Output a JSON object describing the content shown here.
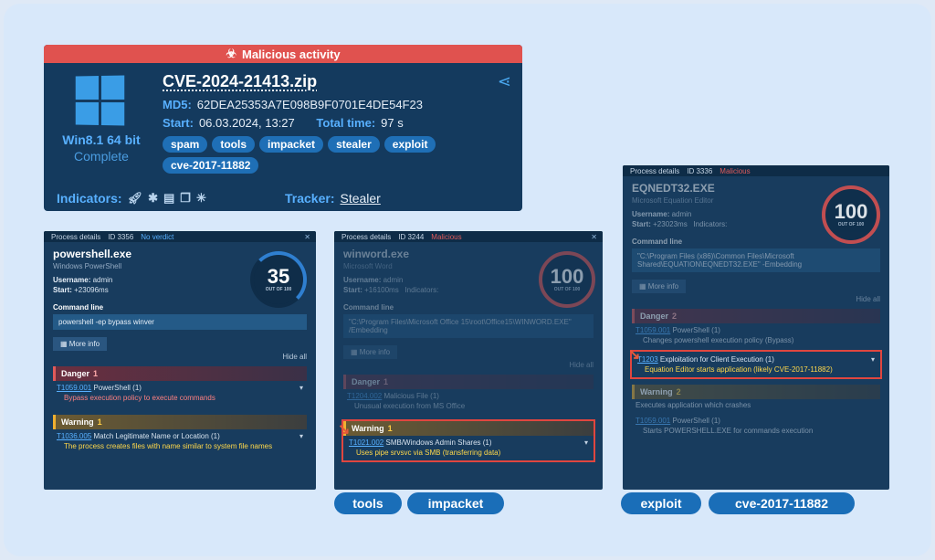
{
  "summary": {
    "banner": "Malicious activity",
    "os": "Win8.1 64 bit",
    "status": "Complete",
    "filename": "CVE-2024-21413.zip",
    "md5_label": "MD5:",
    "md5": "62DEA25353A7E098B9F0701E4DE54F23",
    "start_label": "Start:",
    "start": "06.03.2024, 13:27",
    "total_label": "Total time:",
    "total": "97 s",
    "tags": [
      "spam",
      "tools",
      "impacket",
      "stealer",
      "exploit",
      "cve-2017-11882"
    ],
    "indicators_label": "Indicators:",
    "tracker_label": "Tracker:",
    "tracker": "Stealer"
  },
  "p1": {
    "hdr": "Process details",
    "id": "ID 3356",
    "verdict": "No verdict",
    "name": "powershell.exe",
    "sub": "Windows PowerShell",
    "user_label": "Username:",
    "user": "admin",
    "start_label": "Start:",
    "start": "+23096ms",
    "score": "35",
    "outof": "OUT OF 100",
    "cmd_label": "Command line",
    "cmd": "powershell -ep bypass winver",
    "more": "More info",
    "hide": "Hide all",
    "danger": "Danger",
    "danger_count": "1",
    "d1_id": "T1059.001",
    "d1_text": " PowerShell (1)",
    "d1_desc": "Bypass execution policy to execute commands",
    "warning": "Warning",
    "warning_count": "1",
    "w1_id": "T1036.005",
    "w1_text": " Match Legitimate Name or Location (1)",
    "w1_desc": "The process creates files with name similar to system file names"
  },
  "p2": {
    "hdr": "Process details",
    "id": "ID 3244",
    "verdict": "Malicious",
    "name": "winword.exe",
    "sub": "Microsoft Word",
    "user_label": "Username:",
    "user": "admin",
    "start_label": "Start:",
    "start": "+16100ms",
    "ind_label": "Indicators:",
    "score": "100",
    "outof": "OUT OF 100",
    "cmd_label": "Command line",
    "cmd": "\"C:\\Program Files\\Microsoft Office 15\\root\\Office15\\WINWORD.EXE\" /Embedding",
    "more": "More info",
    "hide": "Hide all",
    "danger": "Danger",
    "danger_count": "1",
    "d1_id": "T1204.002",
    "d1_text": " Malicious File (1)",
    "d1_desc": "Unusual execution from MS Office",
    "warning": "Warning",
    "warning_count": "1",
    "w1_id": "T1021.002",
    "w1_text": " SMB/Windows Admin Shares (1)",
    "w1_desc": "Uses pipe srvsvc via SMB (transferring data)"
  },
  "p3": {
    "hdr": "Process details",
    "id": "ID 3336",
    "verdict": "Malicious",
    "name": "EQNEDT32.EXE",
    "sub": "Microsoft Equation Editor",
    "user_label": "Username:",
    "user": "admin",
    "start_label": "Start:",
    "start": "+23023ms",
    "ind_label": "Indicators:",
    "score": "100",
    "outof": "OUT OF 100",
    "cmd_label": "Command line",
    "cmd": "\"C:\\Program Files (x86)\\Common Files\\Microsoft Shared\\EQUATION\\EQNEDT32.EXE\" -Embedding",
    "more": "More info",
    "hide": "Hide all",
    "danger": "Danger",
    "danger_count": "2",
    "d1_id": "T1059.001",
    "d1_text": " PowerShell (1)",
    "d1_desc": "Changes powershell execution policy (Bypass)",
    "d2_id": "T1203",
    "d2_text": " Exploitation for Client Execution (1)",
    "d2_desc": "Equation Editor starts application (likely CVE-2017-11882)",
    "warning": "Warning",
    "warning_count": "2",
    "w0_desc": "Executes application which crashes",
    "w1_id": "T1059.001",
    "w1_text": " PowerShell (1)",
    "w1_desc": "Starts POWERSHELL.EXE for commands execution"
  },
  "bottom_tags": [
    "tools",
    "impacket",
    "exploit",
    "cve-2017-11882"
  ]
}
